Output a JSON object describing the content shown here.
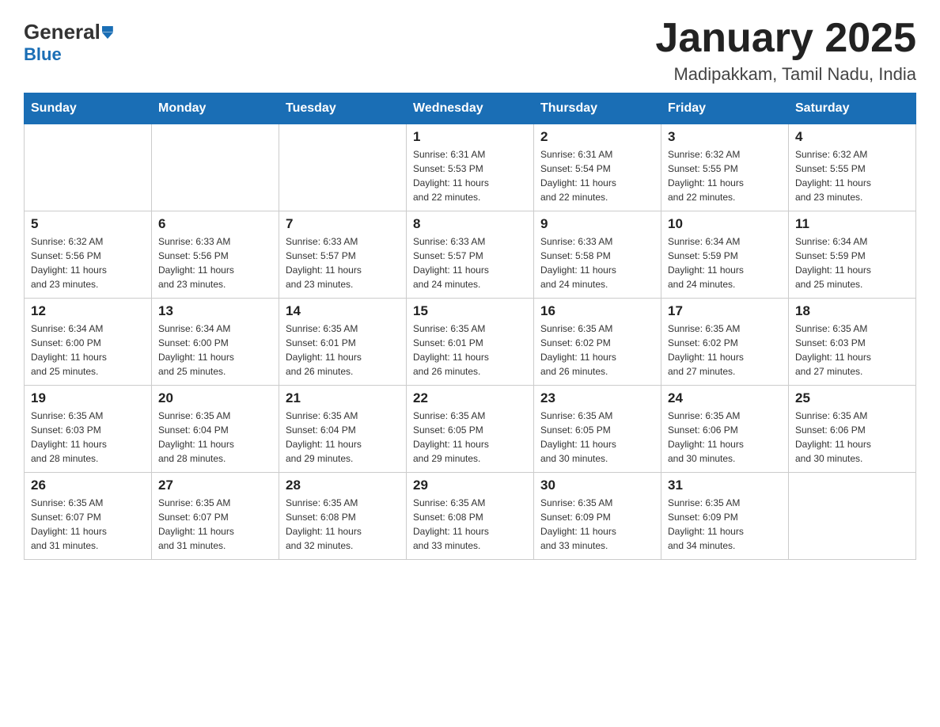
{
  "logo": {
    "general": "General",
    "blue": "Blue"
  },
  "title": "January 2025",
  "location": "Madipakkam, Tamil Nadu, India",
  "days_of_week": [
    "Sunday",
    "Monday",
    "Tuesday",
    "Wednesday",
    "Thursday",
    "Friday",
    "Saturday"
  ],
  "weeks": [
    [
      {
        "day": "",
        "info": ""
      },
      {
        "day": "",
        "info": ""
      },
      {
        "day": "",
        "info": ""
      },
      {
        "day": "1",
        "info": "Sunrise: 6:31 AM\nSunset: 5:53 PM\nDaylight: 11 hours\nand 22 minutes."
      },
      {
        "day": "2",
        "info": "Sunrise: 6:31 AM\nSunset: 5:54 PM\nDaylight: 11 hours\nand 22 minutes."
      },
      {
        "day": "3",
        "info": "Sunrise: 6:32 AM\nSunset: 5:55 PM\nDaylight: 11 hours\nand 22 minutes."
      },
      {
        "day": "4",
        "info": "Sunrise: 6:32 AM\nSunset: 5:55 PM\nDaylight: 11 hours\nand 23 minutes."
      }
    ],
    [
      {
        "day": "5",
        "info": "Sunrise: 6:32 AM\nSunset: 5:56 PM\nDaylight: 11 hours\nand 23 minutes."
      },
      {
        "day": "6",
        "info": "Sunrise: 6:33 AM\nSunset: 5:56 PM\nDaylight: 11 hours\nand 23 minutes."
      },
      {
        "day": "7",
        "info": "Sunrise: 6:33 AM\nSunset: 5:57 PM\nDaylight: 11 hours\nand 23 minutes."
      },
      {
        "day": "8",
        "info": "Sunrise: 6:33 AM\nSunset: 5:57 PM\nDaylight: 11 hours\nand 24 minutes."
      },
      {
        "day": "9",
        "info": "Sunrise: 6:33 AM\nSunset: 5:58 PM\nDaylight: 11 hours\nand 24 minutes."
      },
      {
        "day": "10",
        "info": "Sunrise: 6:34 AM\nSunset: 5:59 PM\nDaylight: 11 hours\nand 24 minutes."
      },
      {
        "day": "11",
        "info": "Sunrise: 6:34 AM\nSunset: 5:59 PM\nDaylight: 11 hours\nand 25 minutes."
      }
    ],
    [
      {
        "day": "12",
        "info": "Sunrise: 6:34 AM\nSunset: 6:00 PM\nDaylight: 11 hours\nand 25 minutes."
      },
      {
        "day": "13",
        "info": "Sunrise: 6:34 AM\nSunset: 6:00 PM\nDaylight: 11 hours\nand 25 minutes."
      },
      {
        "day": "14",
        "info": "Sunrise: 6:35 AM\nSunset: 6:01 PM\nDaylight: 11 hours\nand 26 minutes."
      },
      {
        "day": "15",
        "info": "Sunrise: 6:35 AM\nSunset: 6:01 PM\nDaylight: 11 hours\nand 26 minutes."
      },
      {
        "day": "16",
        "info": "Sunrise: 6:35 AM\nSunset: 6:02 PM\nDaylight: 11 hours\nand 26 minutes."
      },
      {
        "day": "17",
        "info": "Sunrise: 6:35 AM\nSunset: 6:02 PM\nDaylight: 11 hours\nand 27 minutes."
      },
      {
        "day": "18",
        "info": "Sunrise: 6:35 AM\nSunset: 6:03 PM\nDaylight: 11 hours\nand 27 minutes."
      }
    ],
    [
      {
        "day": "19",
        "info": "Sunrise: 6:35 AM\nSunset: 6:03 PM\nDaylight: 11 hours\nand 28 minutes."
      },
      {
        "day": "20",
        "info": "Sunrise: 6:35 AM\nSunset: 6:04 PM\nDaylight: 11 hours\nand 28 minutes."
      },
      {
        "day": "21",
        "info": "Sunrise: 6:35 AM\nSunset: 6:04 PM\nDaylight: 11 hours\nand 29 minutes."
      },
      {
        "day": "22",
        "info": "Sunrise: 6:35 AM\nSunset: 6:05 PM\nDaylight: 11 hours\nand 29 minutes."
      },
      {
        "day": "23",
        "info": "Sunrise: 6:35 AM\nSunset: 6:05 PM\nDaylight: 11 hours\nand 30 minutes."
      },
      {
        "day": "24",
        "info": "Sunrise: 6:35 AM\nSunset: 6:06 PM\nDaylight: 11 hours\nand 30 minutes."
      },
      {
        "day": "25",
        "info": "Sunrise: 6:35 AM\nSunset: 6:06 PM\nDaylight: 11 hours\nand 30 minutes."
      }
    ],
    [
      {
        "day": "26",
        "info": "Sunrise: 6:35 AM\nSunset: 6:07 PM\nDaylight: 11 hours\nand 31 minutes."
      },
      {
        "day": "27",
        "info": "Sunrise: 6:35 AM\nSunset: 6:07 PM\nDaylight: 11 hours\nand 31 minutes."
      },
      {
        "day": "28",
        "info": "Sunrise: 6:35 AM\nSunset: 6:08 PM\nDaylight: 11 hours\nand 32 minutes."
      },
      {
        "day": "29",
        "info": "Sunrise: 6:35 AM\nSunset: 6:08 PM\nDaylight: 11 hours\nand 33 minutes."
      },
      {
        "day": "30",
        "info": "Sunrise: 6:35 AM\nSunset: 6:09 PM\nDaylight: 11 hours\nand 33 minutes."
      },
      {
        "day": "31",
        "info": "Sunrise: 6:35 AM\nSunset: 6:09 PM\nDaylight: 11 hours\nand 34 minutes."
      },
      {
        "day": "",
        "info": ""
      }
    ]
  ]
}
